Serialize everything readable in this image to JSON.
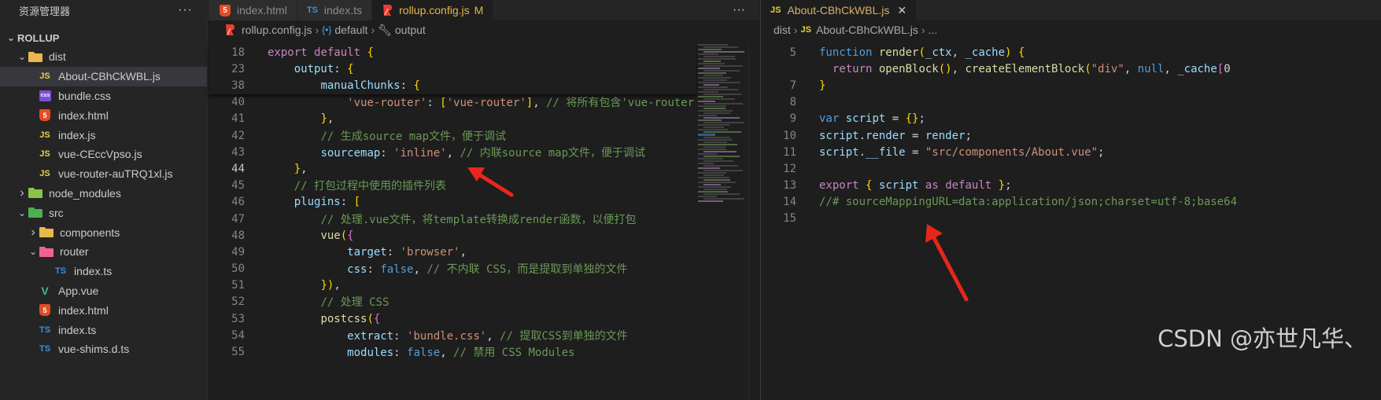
{
  "explorer": {
    "title": "资源管理器",
    "more": "···",
    "section": "ROLLUP",
    "items": [
      {
        "label": "dist",
        "kind": "folder",
        "depth": 1,
        "open": true
      },
      {
        "label": "About-CBhCkWBL.js",
        "kind": "js",
        "depth": 2,
        "selected": true
      },
      {
        "label": "bundle.css",
        "kind": "css",
        "depth": 2
      },
      {
        "label": "index.html",
        "kind": "html",
        "depth": 2
      },
      {
        "label": "index.js",
        "kind": "js",
        "depth": 2
      },
      {
        "label": "vue-CEccVpso.js",
        "kind": "js",
        "depth": 2
      },
      {
        "label": "vue-router-auTRQ1xl.js",
        "kind": "js",
        "depth": 2
      },
      {
        "label": "node_modules",
        "kind": "folder",
        "depth": 1,
        "open": false
      },
      {
        "label": "src",
        "kind": "folder",
        "depth": 1,
        "open": true
      },
      {
        "label": "components",
        "kind": "folder",
        "depth": 2,
        "open": false
      },
      {
        "label": "router",
        "kind": "folder",
        "depth": 2,
        "open": true
      },
      {
        "label": "index.ts",
        "kind": "ts",
        "depth": 3
      },
      {
        "label": "App.vue",
        "kind": "vue",
        "depth": 2
      },
      {
        "label": "index.html",
        "kind": "html",
        "depth": 2
      },
      {
        "label": "index.ts",
        "kind": "ts",
        "depth": 2
      },
      {
        "label": "vue-shims.d.ts",
        "kind": "ts",
        "depth": 2
      }
    ]
  },
  "editor1": {
    "tabs": [
      {
        "label": "index.html",
        "icon": "5",
        "active": false
      },
      {
        "label": "index.ts",
        "icon": "TS",
        "active": false
      },
      {
        "label": "rollup.config.js",
        "icon": "R",
        "active": true,
        "modified": "M"
      }
    ],
    "more": "···",
    "breadcrumb": {
      "file": "rollup.config.js",
      "symbol1": "default",
      "symbol2": "output"
    },
    "sticky": [
      {
        "n": "18",
        "t": "export default {"
      },
      {
        "n": "23",
        "t": "    output: {"
      },
      {
        "n": "38",
        "t": "        manualChunks: {"
      }
    ],
    "lines": [
      {
        "n": "40",
        "t": "            'vue-router': ['vue-router'], // 将所有包含'vue-router"
      },
      {
        "n": "41",
        "t": "        },"
      },
      {
        "n": "42",
        "t": "        // 生成source map文件，便于调试"
      },
      {
        "n": "43",
        "t": "        sourcemap: 'inline', // 内联source map文件，便于调试"
      },
      {
        "n": "44",
        "t": "    },"
      },
      {
        "n": "45",
        "t": "    // 打包过程中使用的插件列表"
      },
      {
        "n": "46",
        "t": "    plugins: ["
      },
      {
        "n": "47",
        "t": "        // 处理.vue文件，将template转换成render函数，以便打包"
      },
      {
        "n": "48",
        "t": "        vue({"
      },
      {
        "n": "49",
        "t": "            target: 'browser',"
      },
      {
        "n": "50",
        "t": "            css: false, // 不内联 CSS，而是提取到单独的文件"
      },
      {
        "n": "51",
        "t": "        }),"
      },
      {
        "n": "52",
        "t": "        // 处理 CSS"
      },
      {
        "n": "53",
        "t": "        postcss({"
      },
      {
        "n": "54",
        "t": "            extract: 'bundle.css', // 提取CSS到单独的文件"
      },
      {
        "n": "55",
        "t": "            modules: false, // 禁用 CSS Modules"
      }
    ]
  },
  "editor2": {
    "tab": {
      "label": "About-CBhCkWBL.js",
      "icon": "JS",
      "close": "✕"
    },
    "breadcrumb": {
      "folder": "dist",
      "file": "About-CBhCkWBL.js",
      "rest": "..."
    },
    "lines": [
      {
        "n": "5",
        "t": "function render(_ctx, _cache) {"
      },
      {
        "n": "",
        "t": "  return openBlock(), createElementBlock(\"div\", null, _cache[0"
      },
      {
        "n": "7",
        "t": "}"
      },
      {
        "n": "8",
        "t": ""
      },
      {
        "n": "9",
        "t": "var script = {};"
      },
      {
        "n": "10",
        "t": "script.render = render;"
      },
      {
        "n": "11",
        "t": "script.__file = \"src/components/About.vue\";"
      },
      {
        "n": "12",
        "t": ""
      },
      {
        "n": "13",
        "t": "export { script as default };"
      },
      {
        "n": "14",
        "t": "//# sourceMappingURL=data:application/json;charset=utf-8;base64"
      },
      {
        "n": "15",
        "t": ""
      }
    ]
  },
  "watermark": "CSDN @亦世凡华、",
  "colors": {
    "arrow": "#e8261c",
    "accent": "#e8b54a"
  }
}
